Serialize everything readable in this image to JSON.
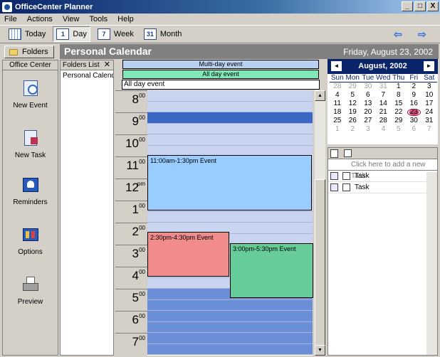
{
  "window": {
    "title": "OfficeCenter Planner",
    "minimize": "_",
    "maximize": "□",
    "close": "X"
  },
  "menu": [
    "File",
    "Actions",
    "View",
    "Tools",
    "Help"
  ],
  "toolbar": {
    "today": "Today",
    "day": "Day",
    "day_icon": "1",
    "week": "Week",
    "week_icon": "7",
    "month": "Month",
    "month_icon": "31",
    "back_arrow": "⇦",
    "forward_arrow": "⇨"
  },
  "folders_button": "Folders",
  "header": {
    "title": "Personal Calendar",
    "date": "Friday, August 23, 2002"
  },
  "office_center": {
    "title": "Office Center",
    "items": [
      "New Event",
      "New Task",
      "Reminders",
      "Options",
      "Preview"
    ]
  },
  "folders_list": {
    "title": "Folders List",
    "close": "✕",
    "items": [
      "Personal Calendar"
    ]
  },
  "dayview": {
    "multi_day": "Multi-day event",
    "all_day_bar": "All day event",
    "all_day_label": "All day event",
    "hours": [
      {
        "h": "8",
        "m": "00"
      },
      {
        "h": "9",
        "m": "00"
      },
      {
        "h": "10",
        "m": "00"
      },
      {
        "h": "11",
        "m": "00"
      },
      {
        "h": "12",
        "m": "pm"
      },
      {
        "h": "1",
        "m": "00"
      },
      {
        "h": "2",
        "m": "00"
      },
      {
        "h": "3",
        "m": "00"
      },
      {
        "h": "4",
        "m": "00"
      },
      {
        "h": "5",
        "m": "00"
      },
      {
        "h": "6",
        "m": "00"
      },
      {
        "h": "7",
        "m": "00"
      }
    ],
    "events": [
      {
        "label": "11:00am-1:30pm Event"
      },
      {
        "label": "2:30pm-4:30pm Event"
      },
      {
        "label": "3:00pm-5:30pm Event"
      }
    ]
  },
  "minical": {
    "title": "August, 2002",
    "prev": "◄",
    "next": "►",
    "dow": [
      "Sun",
      "Mon",
      "Tue",
      "Wed",
      "Thu",
      "Fri",
      "Sat"
    ],
    "weeks": [
      [
        "28",
        "29",
        "30",
        "31",
        "1",
        "2",
        "3"
      ],
      [
        "4",
        "5",
        "6",
        "7",
        "8",
        "9",
        "10"
      ],
      [
        "11",
        "12",
        "13",
        "14",
        "15",
        "16",
        "17"
      ],
      [
        "18",
        "19",
        "20",
        "21",
        "22",
        "23",
        "24"
      ],
      [
        "25",
        "26",
        "27",
        "28",
        "29",
        "30",
        "31"
      ],
      [
        "1",
        "2",
        "3",
        "4",
        "5",
        "6",
        "7"
      ]
    ]
  },
  "tasks": {
    "add_placeholder": "Click here to add a new Task",
    "items": [
      "Task",
      "Task"
    ]
  },
  "colors": {
    "event1": "#99ccff",
    "event2": "#f08c8c",
    "event3": "#66cc99",
    "busy": "#6a8fd6",
    "selected": "#3a66c4"
  }
}
